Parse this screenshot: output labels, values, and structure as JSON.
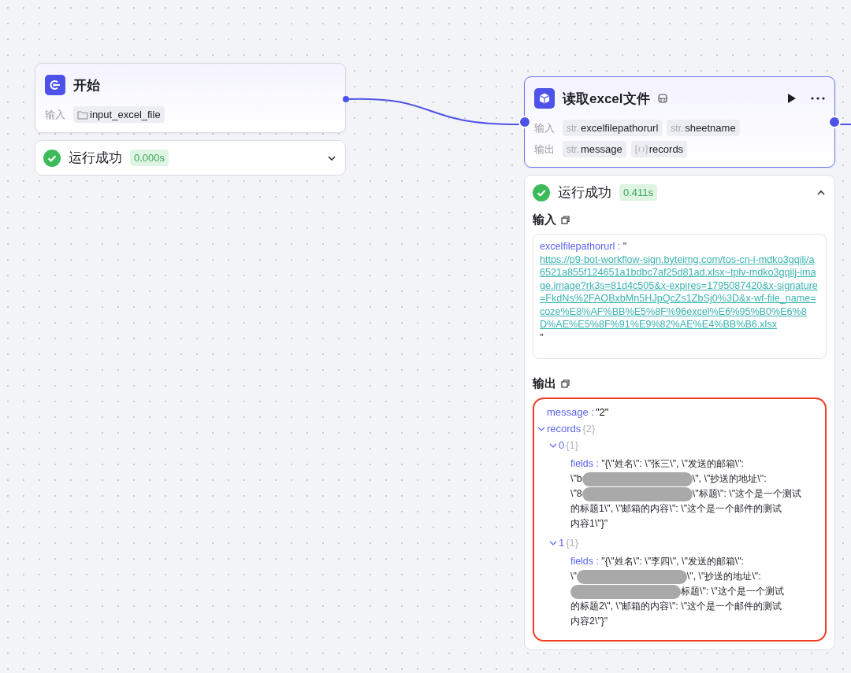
{
  "nodes": [
    {
      "kind": "start",
      "title": "开始",
      "selected": false,
      "ports": [
        {
          "label": "输入",
          "params": [
            {
              "kind": "file",
              "name": "input_excel_file"
            }
          ]
        }
      ],
      "status": {
        "label": "运行成功",
        "duration": "0.000s",
        "expanded": false
      }
    },
    {
      "kind": "plugin",
      "title": "读取excel文件",
      "selected": true,
      "ports": [
        {
          "label": "输入",
          "params": [
            {
              "kind": "str",
              "tag": "str.",
              "name": "excelfilepathorurl"
            },
            {
              "kind": "str",
              "tag": "str.",
              "name": "sheetname"
            }
          ]
        },
        {
          "label": "输出",
          "params": [
            {
              "kind": "str",
              "tag": "str.",
              "name": "message"
            },
            {
              "kind": "array",
              "name": "records"
            }
          ]
        }
      ],
      "status": {
        "label": "运行成功",
        "duration": "0.411s",
        "expanded": true,
        "input": {
          "title": "输入",
          "key": "excelfilepathorurl",
          "sep": " : ",
          "open_quote": "\"",
          "close_quote": "\"",
          "url": "https://p9-bot-workflow-sign.byteimg.com/tos-cn-i-mdko3gqilj/a6521a855f124651a1bdbc7af25d81ad.xlsx~tplv-mdko3gqilj-image.image?rk3s=81d4c505&x-expires=1795087420&x-signature=FkdNs%2FAOBxbMn5HJpQcZs1ZbSj0%3D&x-wf-file_name=coze%E8%AF%BB%E5%8F%96excel%E6%95%B0%E6%8D%AE%E5%8F%91%E9%82%AE%E4%BB%B6.xlsx"
        },
        "output": {
          "title": "输出",
          "highlighted": true,
          "items": [
            {
              "key": "message",
              "sep": " : ",
              "value": "\"2\""
            },
            {
              "key": "records",
              "count": "{2}",
              "expanded": true,
              "children": [
                {
                  "key": "0",
                  "count": "{1}",
                  "expanded": true,
                  "children": [
                    {
                      "key": "fields",
                      "sep": " : ",
                      "lines": [
                        [
                          {
                            "kind": "text",
                            "text": "\"{\\\"姓名\\\": \\\"张三\\\", \\\"发送的邮箱\\\":"
                          }
                        ],
                        [
                          {
                            "kind": "text",
                            "text": "\\\"b"
                          },
                          {
                            "kind": "redacted"
                          },
                          {
                            "kind": "text",
                            "text": "\\\", \\\"抄送的地址\\\":"
                          }
                        ],
                        [
                          {
                            "kind": "text",
                            "text": "\\\"8"
                          },
                          {
                            "kind": "redacted"
                          },
                          {
                            "kind": "text",
                            "text": "\\\"标题\\\": \\\"这个是一个测试"
                          }
                        ],
                        [
                          {
                            "kind": "text",
                            "text": "的标题1\\\", \\\"邮箱的内容\\\": \\\"这个是一个邮件的测试"
                          }
                        ],
                        [
                          {
                            "kind": "text",
                            "text": "内容1\\\"}\""
                          }
                        ]
                      ]
                    }
                  ]
                },
                {
                  "key": "1",
                  "count": "{1}",
                  "expanded": true,
                  "children": [
                    {
                      "key": "fields",
                      "sep": " : ",
                      "lines": [
                        [
                          {
                            "kind": "text",
                            "text": "\"{\\\"姓名\\\": \\\"李四\\\", \\\"发送的邮箱\\\":"
                          }
                        ],
                        [
                          {
                            "kind": "text",
                            "text": "\\\""
                          },
                          {
                            "kind": "redacted"
                          },
                          {
                            "kind": "text",
                            "text": "\\\", \\\"抄送的地址\\\":"
                          }
                        ],
                        [
                          {
                            "kind": "redacted"
                          },
                          {
                            "kind": "text",
                            "text": "标题\\\": \\\"这个是一个测试"
                          }
                        ],
                        [
                          {
                            "kind": "text",
                            "text": "的标题2\\\", \\\"邮箱的内容\\\": \\\"这个是一个邮件的测试"
                          }
                        ],
                        [
                          {
                            "kind": "text",
                            "text": "内容2\\\"}\""
                          }
                        ]
                      ]
                    }
                  ]
                }
              ]
            }
          ]
        }
      }
    }
  ]
}
